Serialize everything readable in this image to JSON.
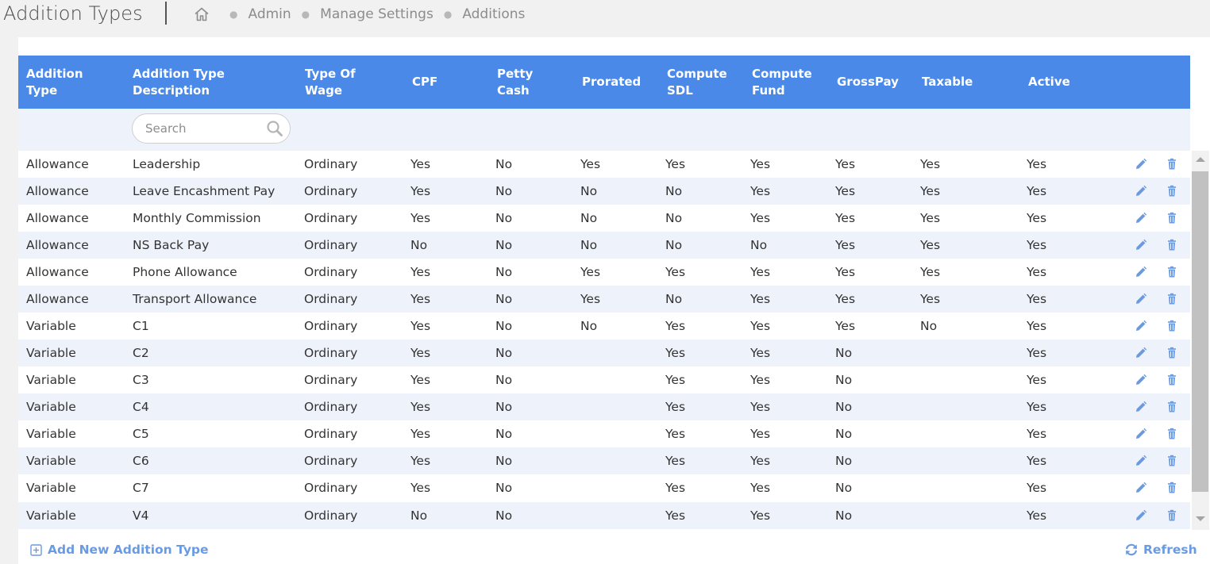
{
  "header": {
    "title": "Addition Types",
    "breadcrumb": [
      "Admin",
      "Manage Settings",
      "Additions"
    ]
  },
  "colors": {
    "accent": "#4a89e8",
    "link": "#6a9be2",
    "row_alt": "#eef3fb"
  },
  "table": {
    "columns": [
      "Addition Type",
      "Addition Type Description",
      "Type Of Wage",
      "CPF",
      "Petty Cash",
      "Prorated",
      "Compute SDL",
      "Compute Fund",
      "GrossPay",
      "Taxable",
      "Active"
    ],
    "search_placeholder": "Search",
    "rows": [
      [
        "Allowance",
        "Leadership",
        "Ordinary",
        "Yes",
        "No",
        "Yes",
        "Yes",
        "Yes",
        "Yes",
        "Yes",
        "Yes"
      ],
      [
        "Allowance",
        "Leave Encashment Pay",
        "Ordinary",
        "Yes",
        "No",
        "No",
        "No",
        "Yes",
        "Yes",
        "Yes",
        "Yes"
      ],
      [
        "Allowance",
        "Monthly Commission",
        "Ordinary",
        "Yes",
        "No",
        "No",
        "No",
        "Yes",
        "Yes",
        "Yes",
        "Yes"
      ],
      [
        "Allowance",
        "NS Back Pay",
        "Ordinary",
        "No",
        "No",
        "No",
        "No",
        "No",
        "Yes",
        "Yes",
        "Yes"
      ],
      [
        "Allowance",
        "Phone Allowance",
        "Ordinary",
        "Yes",
        "No",
        "Yes",
        "Yes",
        "Yes",
        "Yes",
        "Yes",
        "Yes"
      ],
      [
        "Allowance",
        "Transport Allowance",
        "Ordinary",
        "Yes",
        "No",
        "Yes",
        "No",
        "Yes",
        "Yes",
        "Yes",
        "Yes"
      ],
      [
        "Variable",
        "C1",
        "Ordinary",
        "Yes",
        "No",
        "No",
        "Yes",
        "Yes",
        "Yes",
        "No",
        "Yes"
      ],
      [
        "Variable",
        "C2",
        "Ordinary",
        "Yes",
        "No",
        "",
        "Yes",
        "Yes",
        "No",
        "",
        "Yes"
      ],
      [
        "Variable",
        "C3",
        "Ordinary",
        "Yes",
        "No",
        "",
        "Yes",
        "Yes",
        "No",
        "",
        "Yes"
      ],
      [
        "Variable",
        "C4",
        "Ordinary",
        "Yes",
        "No",
        "",
        "Yes",
        "Yes",
        "No",
        "",
        "Yes"
      ],
      [
        "Variable",
        "C5",
        "Ordinary",
        "Yes",
        "No",
        "",
        "Yes",
        "Yes",
        "No",
        "",
        "Yes"
      ],
      [
        "Variable",
        "C6",
        "Ordinary",
        "Yes",
        "No",
        "",
        "Yes",
        "Yes",
        "No",
        "",
        "Yes"
      ],
      [
        "Variable",
        "C7",
        "Ordinary",
        "Yes",
        "No",
        "",
        "Yes",
        "Yes",
        "No",
        "",
        "Yes"
      ],
      [
        "Variable",
        "V4",
        "Ordinary",
        "No",
        "No",
        "",
        "Yes",
        "Yes",
        "No",
        "",
        "Yes"
      ]
    ],
    "row_icons": {
      "edit": "pencil-icon",
      "delete": "trash-icon"
    }
  },
  "footer": {
    "add_label": "Add New Addition Type",
    "refresh_label": "Refresh"
  }
}
